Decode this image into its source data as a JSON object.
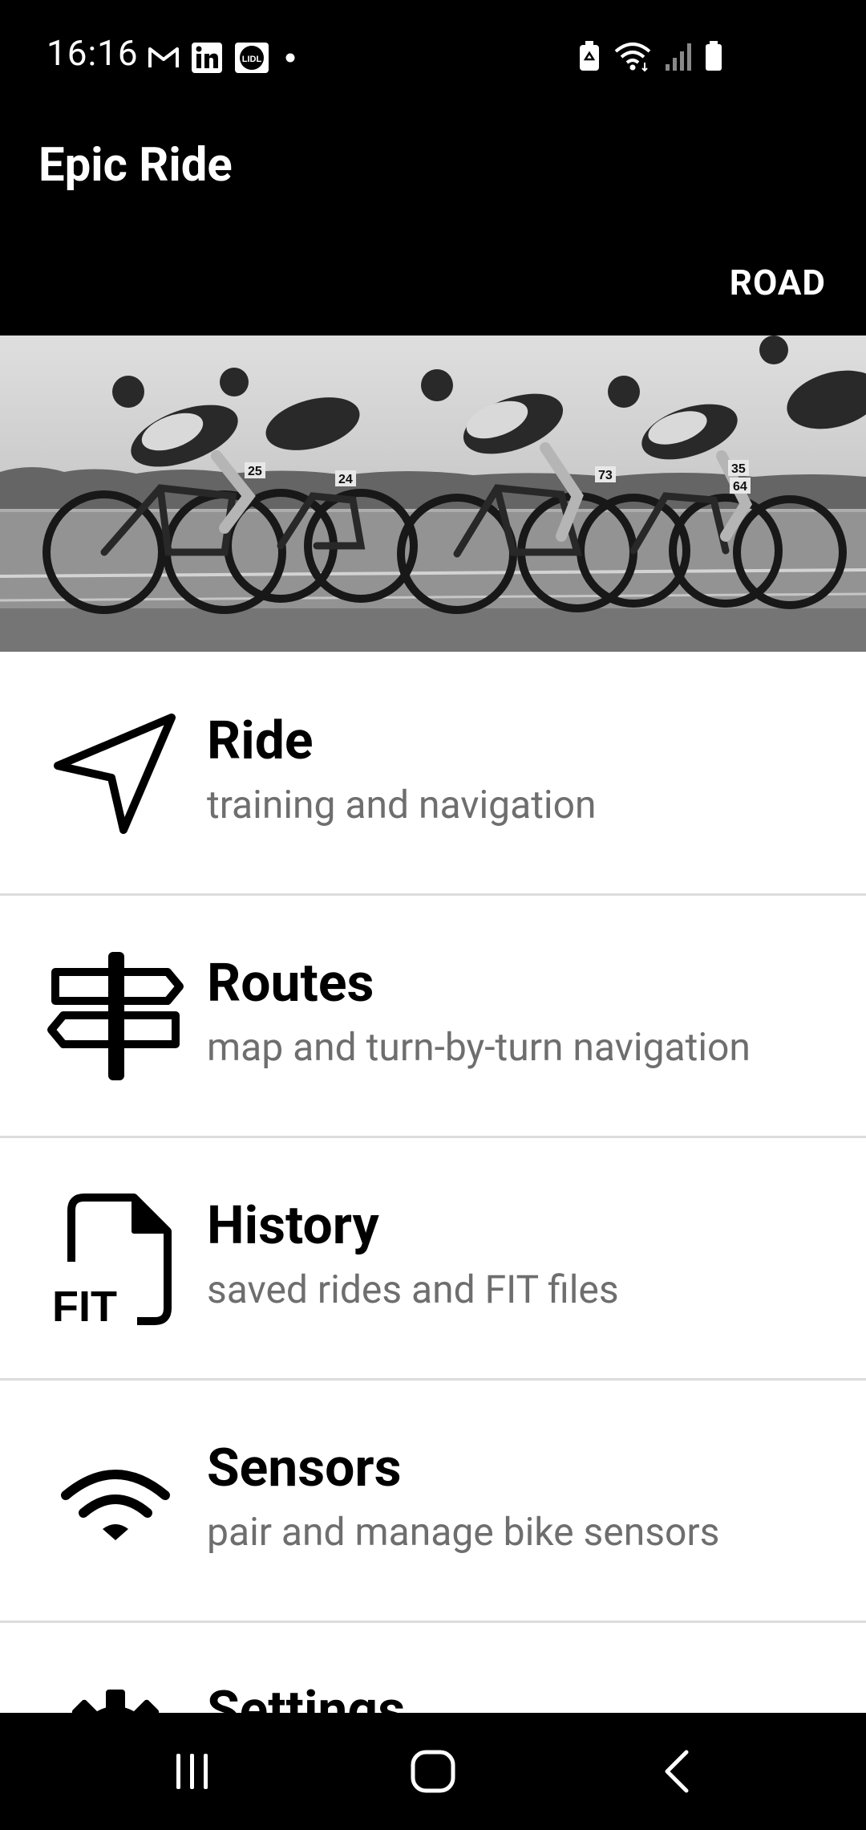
{
  "status_bar": {
    "time": "16:16",
    "notification_icons": [
      "gmail-icon",
      "linkedin-icon",
      "lidl-icon",
      "dot-icon"
    ],
    "system_icons": [
      "battery-saver-icon",
      "wifi-icon",
      "signal-icon",
      "battery-icon"
    ]
  },
  "app_bar": {
    "title": "Epic Ride",
    "mode": "ROAD"
  },
  "hero": {
    "description": "cyclists racing photo",
    "bib_numbers": [
      "25",
      "24",
      "73",
      "35",
      "64"
    ]
  },
  "menu": {
    "items": [
      {
        "icon": "navigation-arrow-icon",
        "title": "Ride",
        "subtitle": "training and navigation"
      },
      {
        "icon": "signpost-icon",
        "title": "Routes",
        "subtitle": "map and turn-by-turn navigation"
      },
      {
        "icon": "fit-file-icon",
        "title": "History",
        "subtitle": "saved rides and FIT files",
        "icon_text": "FIT"
      },
      {
        "icon": "wifi-sensor-icon",
        "title": "Sensors",
        "subtitle": "pair and manage bike sensors"
      },
      {
        "icon": "settings-gear-icon",
        "title": "Settings",
        "subtitle": ""
      }
    ]
  },
  "nav_bar": {
    "buttons": [
      "recents-icon",
      "home-icon",
      "back-icon"
    ]
  },
  "colors": {
    "bar_background": "#000000",
    "title_text": "#000000",
    "subtitle_text": "#6e6e6e",
    "divider": "#dcdcdc"
  }
}
